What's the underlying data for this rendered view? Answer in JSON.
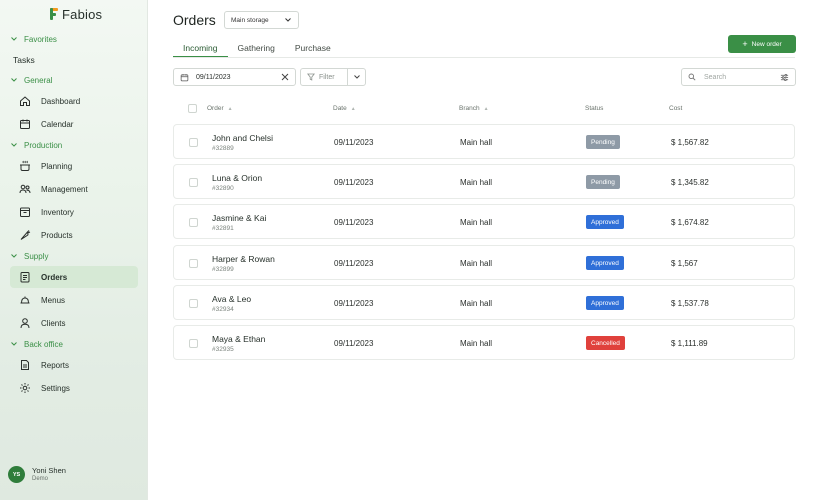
{
  "app": {
    "name": "Fabios"
  },
  "sidebar": {
    "favorites_label": "Favorites",
    "tasks_label": "Tasks",
    "general_label": "General",
    "production_label": "Production",
    "supply_label": "Supply",
    "backoffice_label": "Back office",
    "items": {
      "dashboard": "Dashboard",
      "calendar": "Calendar",
      "planning": "Planning",
      "management": "Management",
      "inventory": "Inventory",
      "products": "Products",
      "orders": "Orders",
      "menus": "Menus",
      "clients": "Clients",
      "reports": "Reports",
      "settings": "Settings"
    },
    "user": {
      "initials": "YS",
      "name": "Yoni Shen",
      "role": "Demo"
    }
  },
  "header": {
    "title": "Orders",
    "storage": "Main storage",
    "new_button": "New order",
    "tabs": [
      "Incoming",
      "Gathering",
      "Purchase"
    ]
  },
  "toolbar": {
    "date": "09/11/2023",
    "filter_label": "Filter",
    "search_placeholder": "Search"
  },
  "table": {
    "columns": {
      "order": "Order",
      "date": "Date",
      "branch": "Branch",
      "status": "Status",
      "cost": "Cost"
    },
    "rows": [
      {
        "name": "John and Chelsi",
        "number": "#32889",
        "date": "09/11/2023",
        "branch": "Main hall",
        "status": "Pending",
        "cost": "$ 1,567.82"
      },
      {
        "name": "Luna & Orion",
        "number": "#32890",
        "date": "09/11/2023",
        "branch": "Main hall",
        "status": "Pending",
        "cost": "$ 1,345.82"
      },
      {
        "name": "Jasmine & Kai",
        "number": "#32891",
        "date": "09/11/2023",
        "branch": "Main hall",
        "status": "Approved",
        "cost": "$ 1,674.82"
      },
      {
        "name": "Harper & Rowan",
        "number": "#32899",
        "date": "09/11/2023",
        "branch": "Main hall",
        "status": "Approved",
        "cost": "$ 1,567"
      },
      {
        "name": "Ava & Leo",
        "number": "#32934",
        "date": "09/11/2023",
        "branch": "Main hall",
        "status": "Approved",
        "cost": "$ 1,537.78"
      },
      {
        "name": "Maya & Ethan",
        "number": "#32935",
        "date": "09/11/2023",
        "branch": "Main hall",
        "status": "Cancelled",
        "cost": "$ 1,111.89"
      }
    ]
  },
  "colors": {
    "brand": "#3a8f46",
    "pending": "#8e9aa6",
    "approved": "#2f6fd8",
    "cancelled": "#e0413c"
  }
}
